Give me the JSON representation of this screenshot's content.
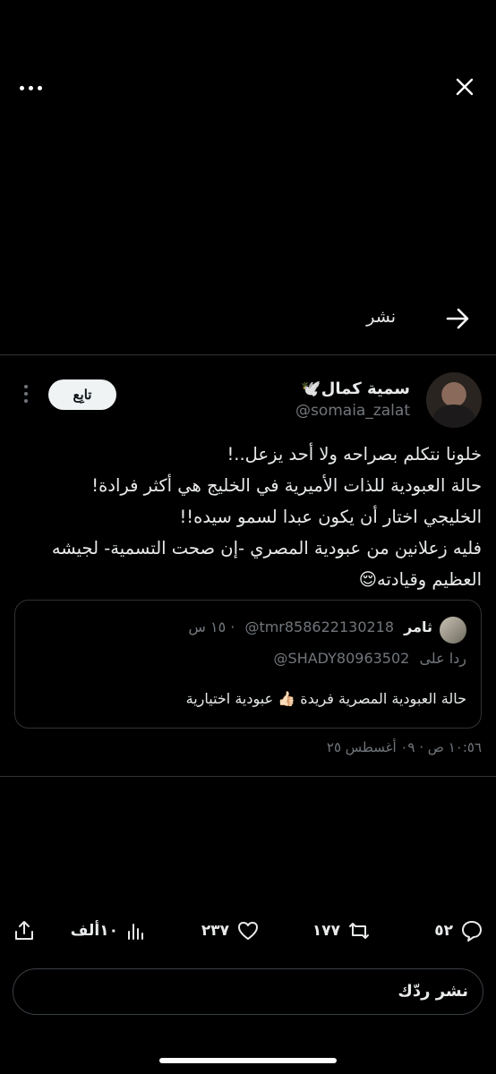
{
  "header": {
    "more_icon": "more-horizontal-icon",
    "close_icon": "close-icon"
  },
  "repost_bar": {
    "label": "نشر",
    "icon": "arrow-right-icon"
  },
  "tweet": {
    "display_name": "سمية كمال🕊️",
    "handle": "@somaia_zalat",
    "follow_label": "تابِع",
    "body_lines": [
      "خلونا نتكلم بصراحه ولا أحد يزعل..!",
      "حالة العبودية للذات الأميرية في الخليج هي أكثر فرادة!",
      "الخليجي اختار أن يكون عبدا لسمو سيده!!",
      "فليه زعلانين من عبودية المصري -إن صحت التسمية- لجيشه",
      "العظيم وقيادته😌"
    ],
    "timestamp": "١٠:٥٦ ص · ٠٩ أغسطس ٢٥"
  },
  "quote": {
    "name": "ثامر",
    "handle": "@tmr858622130218",
    "time": "· ١٥ س",
    "reply_prefix": "ردا على",
    "reply_handle": "@SHADY80963502",
    "text": "حالة العبودية المصرية فريدة 👍🏻 عبودية اختيارية"
  },
  "actions": {
    "replies": "٥٢",
    "reposts": "١٧٧",
    "likes": "٢٣٧",
    "views": "١٠ألف"
  },
  "reply_input": {
    "placeholder": "نشر ردّك"
  }
}
